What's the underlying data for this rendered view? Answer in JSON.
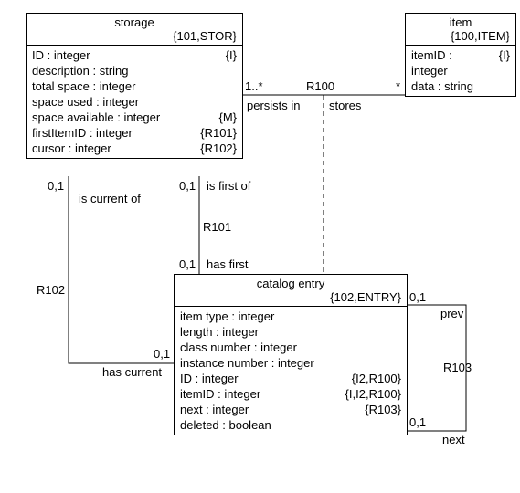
{
  "classes": {
    "storage": {
      "name": "storage",
      "stereotype": "{101,STOR}",
      "attrs": [
        {
          "left": "ID : integer",
          "right": "{I}"
        },
        {
          "left": "description : string",
          "right": ""
        },
        {
          "left": "total space : integer",
          "right": ""
        },
        {
          "left": "space used : integer",
          "right": ""
        },
        {
          "left": "space available : integer",
          "right": "{M}"
        },
        {
          "left": "firstItemID : integer",
          "right": "{R101}"
        },
        {
          "left": "cursor : integer",
          "right": "{R102}"
        }
      ]
    },
    "item": {
      "name": "item",
      "stereotype": "{100,ITEM}",
      "attrs": [
        {
          "left": "itemID : integer",
          "right": "{I}"
        },
        {
          "left": "data : string",
          "right": ""
        }
      ]
    },
    "catalog": {
      "name": "catalog entry",
      "stereotype": "{102,ENTRY}",
      "attrs": [
        {
          "left": "item type : integer",
          "right": ""
        },
        {
          "left": "length : integer",
          "right": ""
        },
        {
          "left": "class number : integer",
          "right": ""
        },
        {
          "left": "instance number : integer",
          "right": ""
        },
        {
          "left": "ID : integer",
          "right": "{I2,R100}"
        },
        {
          "left": "itemID : integer",
          "right": "{I,I2,R100}"
        },
        {
          "left": "next : integer",
          "right": "{R103}"
        },
        {
          "left": "deleted : boolean",
          "right": ""
        }
      ]
    }
  },
  "labels": {
    "r100": "R100",
    "r100_mult_left": "1..*",
    "r100_mult_right": "*",
    "r100_role_left": "persists in",
    "r100_role_right": "stores",
    "r101": "R101",
    "r101_top_mult": "0,1",
    "r101_top_role": "is first of",
    "r101_bot_mult": "0,1",
    "r101_bot_role": "has first",
    "r102": "R102",
    "r102_top_mult": "0,1",
    "r102_top_role": "is current of",
    "r102_bot_mult": "0,1",
    "r102_bot_role": "has current",
    "r103": "R103",
    "r103_top_mult": "0,1",
    "r103_top_role": "prev",
    "r103_bot_mult": "0,1",
    "r103_bot_role": "next"
  }
}
